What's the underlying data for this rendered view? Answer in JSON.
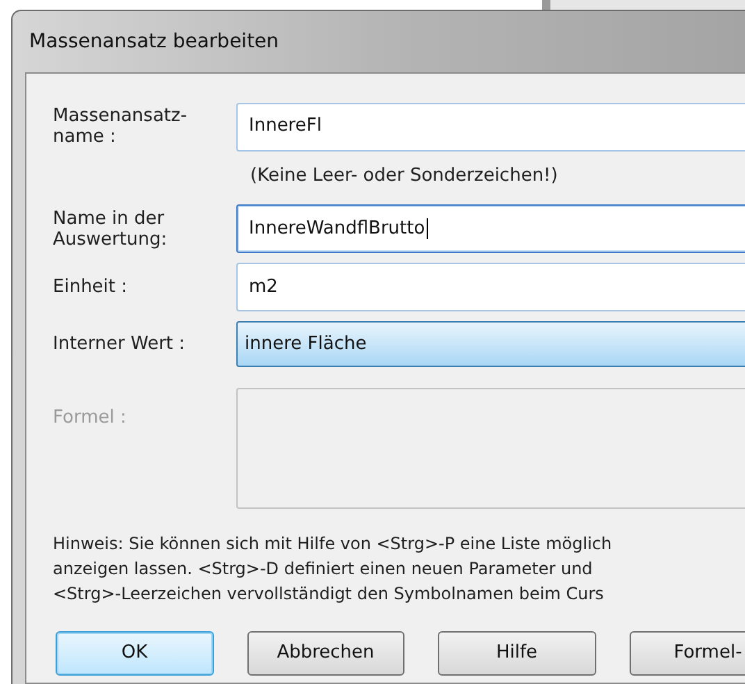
{
  "dialog": {
    "title": "Massenansatz bearbeiten",
    "fields": [
      {
        "kind": "text",
        "label": "Massenansatz-\nname :",
        "value": "InnereFl",
        "focused": false,
        "note": "(Keine Leer- oder Sonderzeichen!)"
      },
      {
        "kind": "text",
        "label": "Name in der\nAuswertung:",
        "value": "InnereWandflBrutto",
        "focused": true
      },
      {
        "kind": "text",
        "label": "Einheit :",
        "value": "m2",
        "focused": false
      },
      {
        "kind": "dropdown",
        "label": "Interner Wert :",
        "value": "innere Fläche",
        "highlighted": true
      },
      {
        "kind": "area",
        "label": "Formel :",
        "disabled": true
      }
    ],
    "hint": "Hinweis: Sie können sich mit Hilfe von <Strg>-P eine Liste möglich\nanzeigen lassen. <Strg>-D definiert einen neuen Parameter und\n<Strg>-Leerzeichen vervollständigt den Symbolnamen beim Curs",
    "buttons": [
      {
        "label": "OK",
        "default": true
      },
      {
        "label": "Abbrechen",
        "default": false
      },
      {
        "label": "Hilfe",
        "default": false
      },
      {
        "label": "Formel-",
        "default": false
      }
    ]
  }
}
